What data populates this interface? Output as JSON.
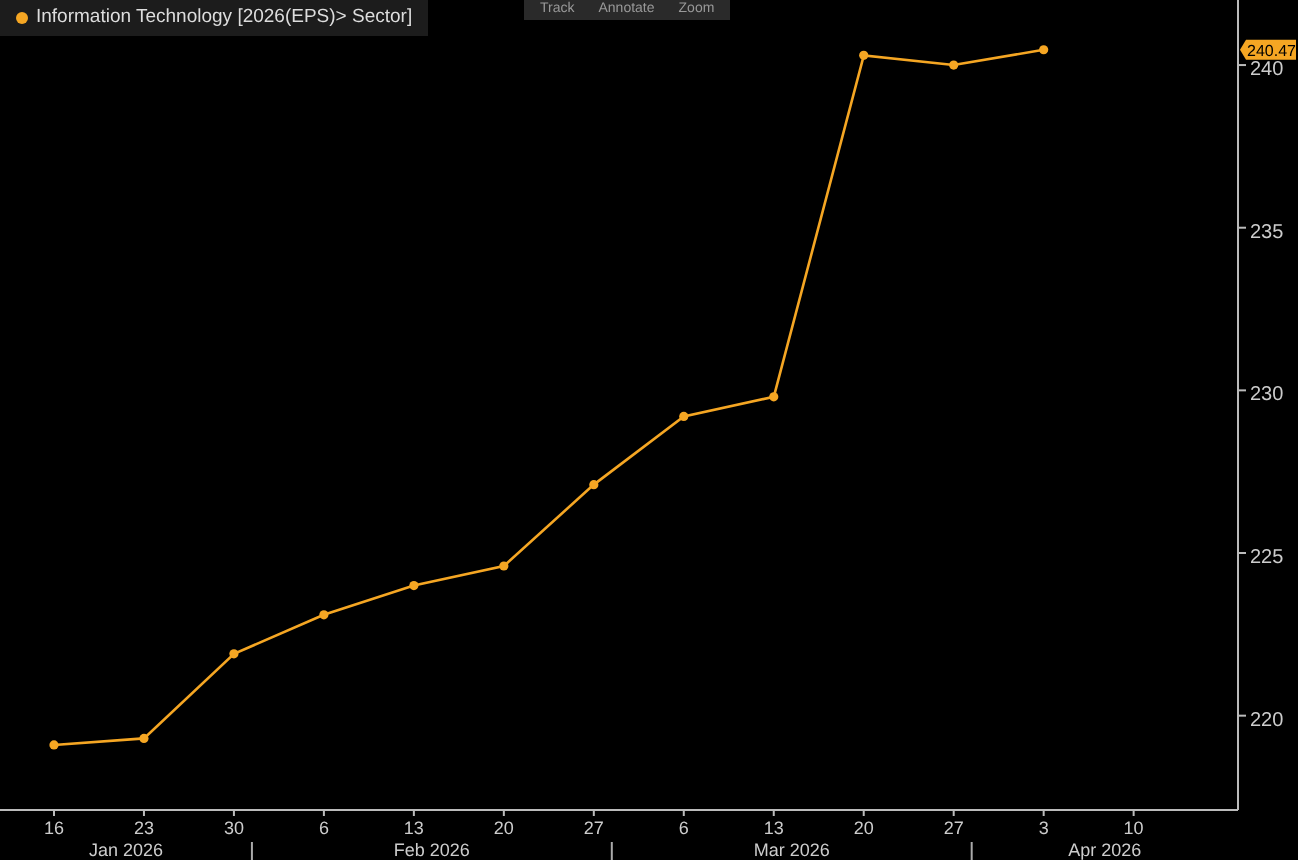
{
  "toolbar": [
    {
      "label": "Track"
    },
    {
      "label": "Annotate"
    },
    {
      "label": "Zoom"
    }
  ],
  "chart_data": {
    "type": "line",
    "categories": [
      "16",
      "23",
      "30",
      "6",
      "13",
      "20",
      "27",
      "6",
      "13",
      "20",
      "27",
      "3",
      "10"
    ],
    "series": [
      {
        "name": "Information Technology [2026(EPS)> Sector]",
        "color": "#f5a623",
        "marker": "circle",
        "values": [
          219.1,
          219.3,
          221.9,
          223.1,
          224.0,
          224.6,
          227.1,
          229.2,
          229.8,
          240.3,
          240.0,
          240.47,
          null
        ]
      }
    ],
    "ylim": [
      217.1,
      242.0
    ],
    "yticks": [
      220,
      225,
      230,
      235,
      240
    ]
  },
  "months": [
    {
      "label": "Jan 2026"
    },
    {
      "label": "Feb 2026"
    },
    {
      "label": "Mar 2026"
    },
    {
      "label": "Apr 2026"
    }
  ],
  "last_value_badge": {
    "label": "240.47"
  }
}
